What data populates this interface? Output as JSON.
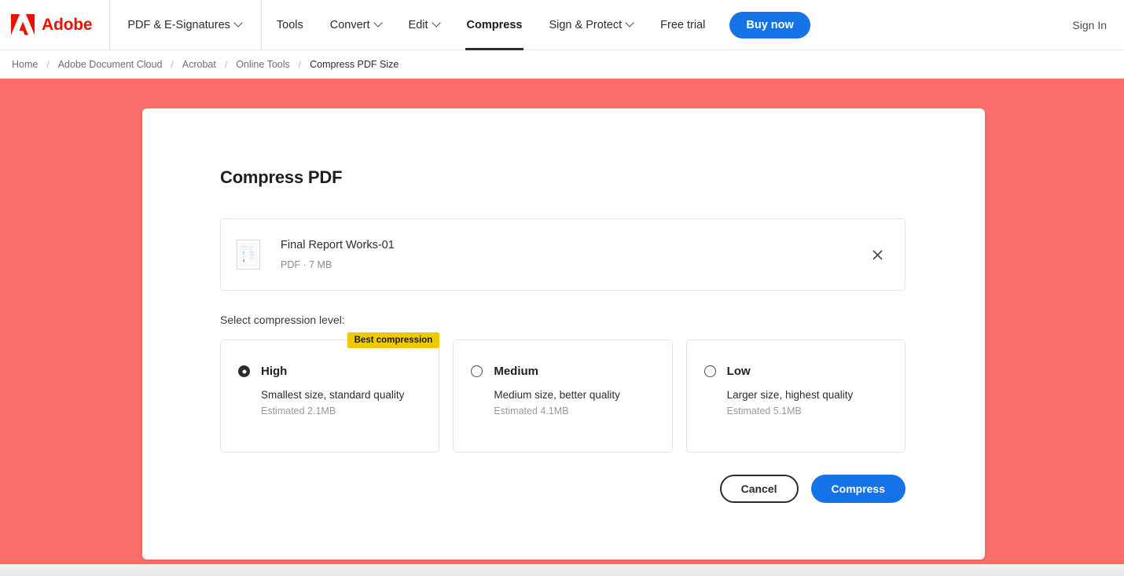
{
  "header": {
    "brand": "Adobe",
    "logo_icon": "adobe-a-logo",
    "logo_color": "#EB1000",
    "nav": [
      {
        "label": "PDF & E-Signatures",
        "has_chevron": true,
        "active": false
      },
      {
        "label": "Tools",
        "has_chevron": false,
        "active": false
      },
      {
        "label": "Convert",
        "has_chevron": true,
        "active": false
      },
      {
        "label": "Edit",
        "has_chevron": true,
        "active": false
      },
      {
        "label": "Compress",
        "has_chevron": false,
        "active": true
      },
      {
        "label": "Sign & Protect",
        "has_chevron": true,
        "active": false
      },
      {
        "label": "Free trial",
        "has_chevron": false,
        "active": false
      }
    ],
    "buy_label": "Buy now",
    "buy_color": "#1473E6",
    "signin_label": "Sign In"
  },
  "breadcrumb": {
    "separator": "/",
    "items": [
      {
        "label": "Home",
        "current": false
      },
      {
        "label": "Adobe Document Cloud",
        "current": false
      },
      {
        "label": "Acrobat",
        "current": false
      },
      {
        "label": "Online Tools",
        "current": false
      },
      {
        "label": "Compress PDF Size",
        "current": true
      }
    ]
  },
  "stage": {
    "background_color": "#FB6E6A"
  },
  "main": {
    "title": "Compress PDF",
    "file": {
      "thumb_icon": "pdf-page-thumbnail",
      "name": "Final Report Works-01",
      "meta": "PDF · 7 MB",
      "close_icon": "close-icon"
    },
    "select_label": "Select compression level:",
    "options": [
      {
        "id": "high",
        "title": "High",
        "description": "Smallest size, standard quality",
        "estimate": "Estimated 2.1MB",
        "selected": true,
        "badge": "Best compression",
        "badge_color": "#EEC900"
      },
      {
        "id": "medium",
        "title": "Medium",
        "description": "Medium size, better quality",
        "estimate": "Estimated 4.1MB",
        "selected": false,
        "badge": null
      },
      {
        "id": "low",
        "title": "Low",
        "description": "Larger size, highest quality",
        "estimate": "Estimated 5.1MB",
        "selected": false,
        "badge": null
      }
    ],
    "actions": {
      "cancel_label": "Cancel",
      "compress_label": "Compress"
    }
  }
}
